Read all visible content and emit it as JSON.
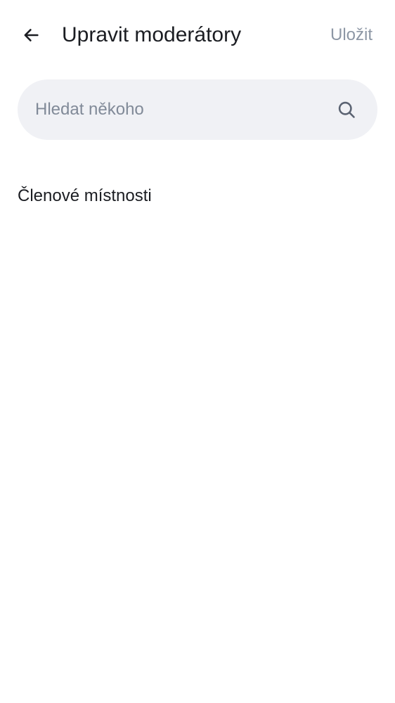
{
  "header": {
    "back_icon": "arrow-left-icon",
    "title": "Upravit moderátory",
    "save_label": "Uložit"
  },
  "search": {
    "placeholder": "Hledat někoho",
    "value": "",
    "icon": "search-icon"
  },
  "members_section": {
    "heading": "Členové místnosti",
    "items": []
  },
  "colors": {
    "background": "#ffffff",
    "text_primary": "#1b1d22",
    "text_disabled": "#8d97a5",
    "search_background": "#f0f1f5",
    "placeholder": "#818a98"
  }
}
